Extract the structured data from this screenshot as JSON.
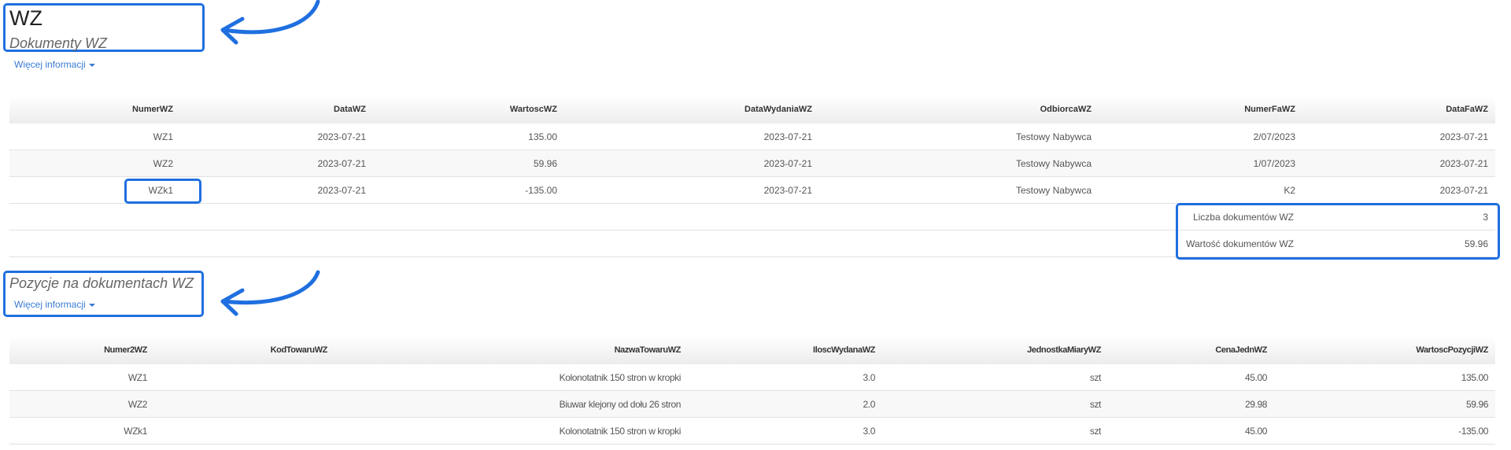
{
  "accent_color": "#1f6fe0",
  "section1": {
    "title": "WZ",
    "subtitle": "Dokumenty WZ",
    "more_label": "Więcej informacji",
    "table": {
      "columns": [
        "NumerWZ",
        "DataWZ",
        "WartoscWZ",
        "DataWydaniaWZ",
        "OdbiorcaWZ",
        "NumerFaWZ",
        "DataFaWZ"
      ],
      "rows": [
        [
          "WZ1",
          "2023-07-21",
          "135.00",
          "2023-07-21",
          "Testowy Nabywca",
          "2/07/2023",
          "2023-07-21"
        ],
        [
          "WZ2",
          "2023-07-21",
          "59.96",
          "2023-07-21",
          "Testowy Nabywca",
          "1/07/2023",
          "2023-07-21"
        ],
        [
          "WZk1",
          "2023-07-21",
          "-135.00",
          "2023-07-21",
          "Testowy Nabywca",
          "K2",
          "2023-07-21"
        ]
      ]
    },
    "summary": [
      {
        "label": "Liczba dokumentów WZ",
        "value": "3"
      },
      {
        "label": "Wartość dokumentów WZ",
        "value": "59.96"
      }
    ]
  },
  "section2": {
    "subtitle": "Pozycje na dokumentach WZ",
    "more_label": "Więcej informacji",
    "table": {
      "columns": [
        "Numer2WZ",
        "KodTowaruWZ",
        "NazwaTowaruWZ",
        "IloscWydanaWZ",
        "JednostkaMiaryWZ",
        "CenaJednWZ",
        "WartoscPozycjiWZ"
      ],
      "rows": [
        [
          "WZ1",
          "",
          "Kolonotatnik 150 stron w kropki",
          "3.0",
          "szt",
          "45.00",
          "135.00"
        ],
        [
          "WZ2",
          "",
          "Biuwar klejony od dołu 26 stron",
          "2.0",
          "szt",
          "29.98",
          "59.96"
        ],
        [
          "WZk1",
          "",
          "Kolonotatnik 150 stron w kropki",
          "3.0",
          "szt",
          "45.00",
          "-135.00"
        ]
      ]
    }
  }
}
